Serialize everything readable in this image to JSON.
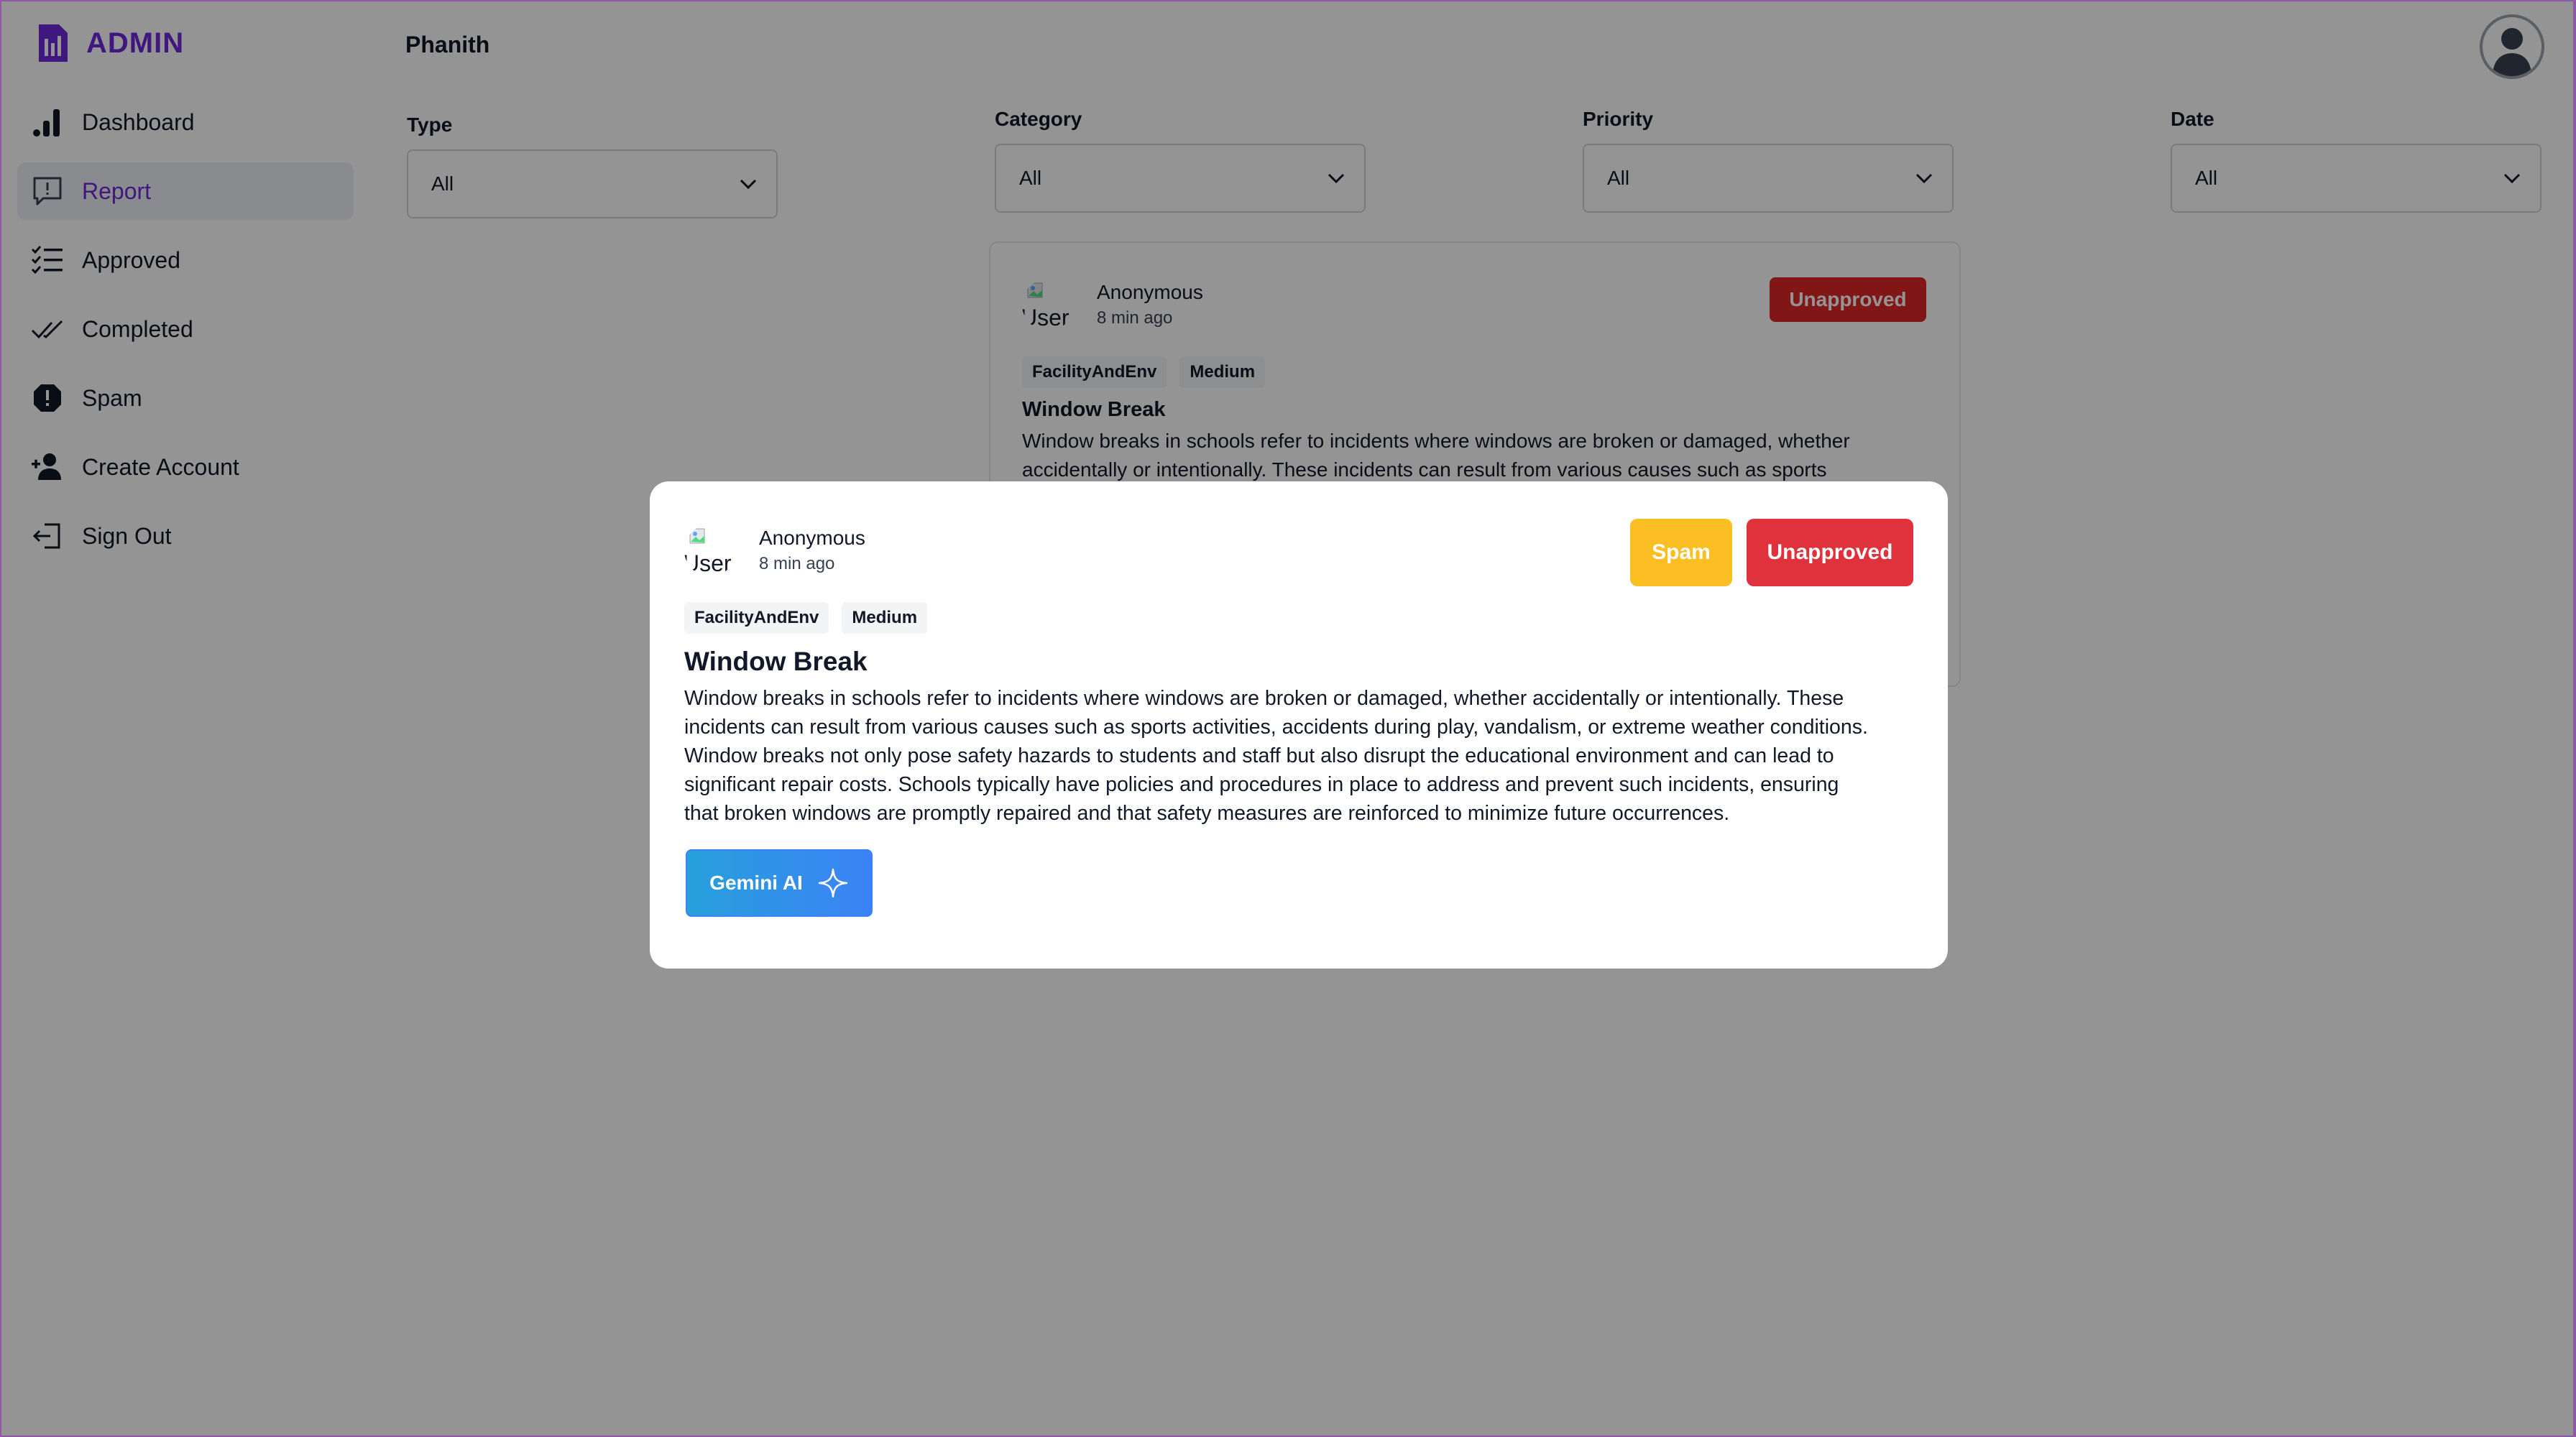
{
  "brand": {
    "title": "ADMIN"
  },
  "sidebar": {
    "items": [
      {
        "label": "Dashboard",
        "icon": "bar-chart-icon",
        "active": false
      },
      {
        "label": "Report",
        "icon": "report-icon",
        "active": true
      },
      {
        "label": "Approved",
        "icon": "checklist-icon",
        "active": false
      },
      {
        "label": "Completed",
        "icon": "double-check-icon",
        "active": false
      },
      {
        "label": "Spam",
        "icon": "alert-icon",
        "active": false
      },
      {
        "label": "Create Account",
        "icon": "add-user-icon",
        "active": false
      },
      {
        "label": "Sign Out",
        "icon": "sign-out-icon",
        "active": false
      }
    ]
  },
  "header": {
    "username": "Phanith"
  },
  "filters": {
    "type": {
      "label": "Type",
      "value": "All"
    },
    "category": {
      "label": "Category",
      "value": "All"
    },
    "priority": {
      "label": "Priority",
      "value": "All"
    },
    "date": {
      "label": "Date",
      "value": "All"
    }
  },
  "background_card": {
    "avatar_alt": "User",
    "name": "Anonymous",
    "time": "8 min ago",
    "status": "Unapproved",
    "tags": [
      "FacilityAndEnv",
      "Medium"
    ],
    "title": "Window Break",
    "excerpt_line1": "Window breaks in schools refer to incidents where windows are broken or damaged, whether",
    "excerpt_line2": "accidentally or intentionally. These incidents can result from various causes such as sports"
  },
  "modal": {
    "avatar_alt": "User",
    "name": "Anonymous",
    "time": "8 min ago",
    "spam_label": "Spam",
    "unapproved_label": "Unapproved",
    "tags": [
      "FacilityAndEnv",
      "Medium"
    ],
    "title": "Window Break",
    "description_lines": [
      "Window breaks in schools refer to incidents where windows are broken or damaged, whether accidentally or intentionally. These",
      "incidents can result from various causes such as sports activities, accidents during play, vandalism, or extreme weather conditions.",
      "Window breaks not only pose safety hazards to students and staff but also disrupt the educational environment and can lead to",
      "significant repair costs. Schools typically have policies and procedures in place to address and prevent such incidents, ensuring",
      "that broken windows are promptly repaired and that safety measures are reinforced to minimize future occurrences."
    ],
    "gemini_label": "Gemini AI"
  },
  "colors": {
    "brand": "#6d28d9",
    "danger": "#e0323d",
    "warning": "#fbbf24",
    "gemini_start": "#27a0dc",
    "gemini_end": "#3b82f6"
  }
}
